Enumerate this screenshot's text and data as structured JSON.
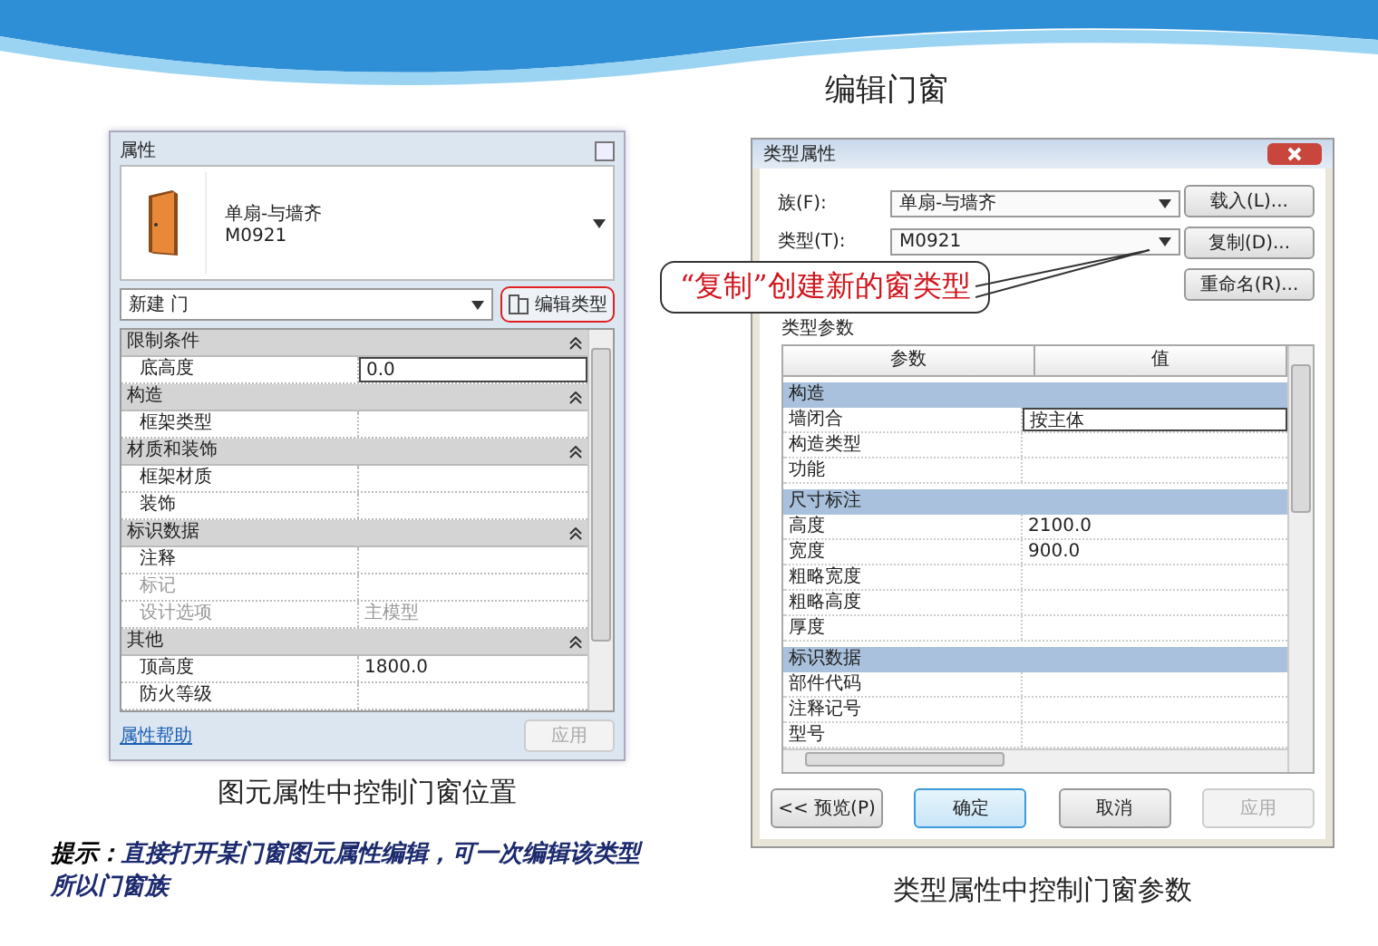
{
  "slide_title": "编辑门窗",
  "properties_panel": {
    "title": "属性",
    "family": "单扇-与墙齐",
    "type": "M0921",
    "instance_filter": "新建 门",
    "edit_type_button": "编辑类型",
    "rows": [
      {
        "kind": "group",
        "label": "限制条件"
      },
      {
        "kind": "param",
        "label": "底高度",
        "value": "0.0",
        "disabled": false,
        "editing": true
      },
      {
        "kind": "group",
        "label": "构造"
      },
      {
        "kind": "param",
        "label": "框架类型",
        "disabled": false,
        "editing": false
      },
      {
        "kind": "group",
        "label": "材质和装饰"
      },
      {
        "kind": "param",
        "label": "框架材质",
        "disabled": false,
        "editing": false
      },
      {
        "kind": "param",
        "label": "装饰",
        "disabled": false,
        "editing": false
      },
      {
        "kind": "group",
        "label": "标识数据"
      },
      {
        "kind": "param",
        "label": "注释",
        "disabled": false,
        "editing": false
      },
      {
        "kind": "param",
        "label": "标记",
        "disabled": true,
        "editing": false
      },
      {
        "kind": "param",
        "label": "设计选项",
        "value": "主模型",
        "disabled": true,
        "editing": false
      },
      {
        "kind": "group",
        "label": "其他"
      },
      {
        "kind": "param",
        "label": "顶高度",
        "value": "1800.0",
        "disabled": false,
        "editing": false
      },
      {
        "kind": "param",
        "label": "防火等级",
        "disabled": false,
        "editing": false
      }
    ],
    "help_link": "属性帮助",
    "apply_button": {
      "label": "应用",
      "disabled": true
    }
  },
  "left_caption": "图元属性中控制门窗位置",
  "tip": {
    "lead": "提示：",
    "text": "直接打开某门窗图元属性编辑，可一次编辑该类型所以门窗族"
  },
  "type_dialog": {
    "title": "类型属性",
    "family_label": "族(F):",
    "family_value": "单扇-与墙齐",
    "type_label": "类型(T):",
    "type_value": "M0921",
    "side_buttons": [
      "载入(L)...",
      "复制(D)...",
      "重命名(R)..."
    ],
    "section_label": "类型参数",
    "columns": [
      "参数",
      "值"
    ],
    "rows": [
      {
        "kind": "group",
        "label": "构造"
      },
      {
        "kind": "param",
        "label": "墙闭合",
        "value": "按主体",
        "editing": true
      },
      {
        "kind": "param",
        "label": "构造类型",
        "editing": false
      },
      {
        "kind": "param",
        "label": "功能",
        "editing": false
      },
      {
        "kind": "group",
        "label": "尺寸标注"
      },
      {
        "kind": "param",
        "label": "高度",
        "value": "2100.0",
        "editing": false
      },
      {
        "kind": "param",
        "label": "宽度",
        "value": "900.0",
        "editing": false
      },
      {
        "kind": "param",
        "label": "粗略宽度",
        "editing": false
      },
      {
        "kind": "param",
        "label": "粗略高度",
        "editing": false
      },
      {
        "kind": "param",
        "label": "厚度",
        "editing": false
      },
      {
        "kind": "group",
        "label": "标识数据"
      },
      {
        "kind": "param",
        "label": "部件代码",
        "editing": false
      },
      {
        "kind": "param",
        "label": "注释记号",
        "editing": false
      },
      {
        "kind": "param",
        "label": "型号",
        "editing": false
      }
    ],
    "buttons": [
      {
        "label": "<< 预览(P)",
        "default": false,
        "disabled": false
      },
      {
        "label": "确定",
        "default": true,
        "disabled": false
      },
      {
        "label": "取消",
        "default": false,
        "disabled": false
      },
      {
        "label": "应用",
        "default": false,
        "disabled": true
      }
    ]
  },
  "callout": "“复制”创建新的窗类型",
  "right_caption": "类型属性中控制门窗参数"
}
